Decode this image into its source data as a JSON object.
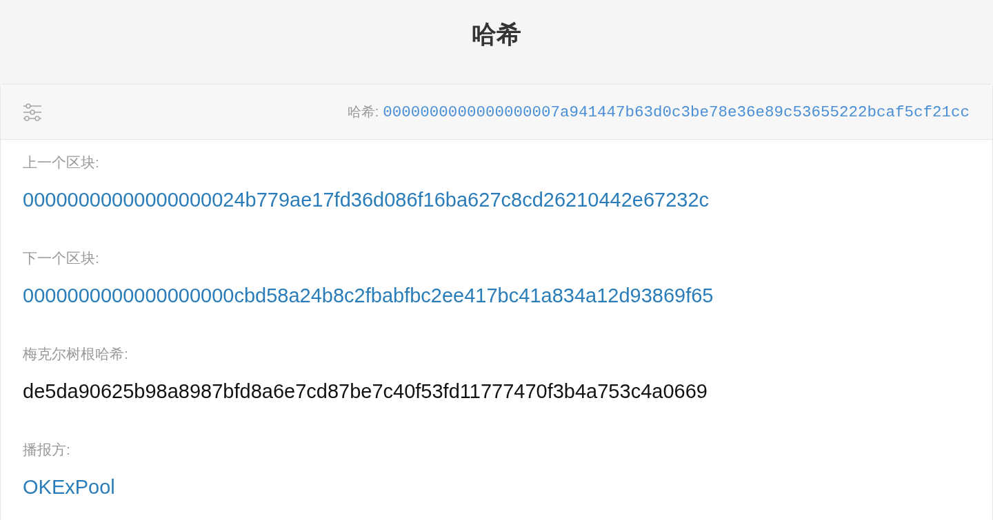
{
  "page_title": "哈希",
  "card": {
    "header": {
      "label": "哈希:",
      "value": "0000000000000000007a941447b63d0c3be78e36e89c53655222bcaf5cf21cc"
    },
    "fields": [
      {
        "label": "上一个区块:",
        "value": "00000000000000000024b779ae17fd36d086f16ba627c8cd26210442e67232c",
        "kind": "link"
      },
      {
        "label": "下一个区块:",
        "value": "0000000000000000000cbd58a24b8c2fbabfbc2ee417bc41a834a12d93869f65",
        "kind": "link"
      },
      {
        "label": "梅克尔树根哈希:",
        "value": "de5da90625b98a8987bfd8a6e7cd87be7c40f53fd11777470f3b4a753c4a0669",
        "kind": "text"
      },
      {
        "label": "播报方:",
        "value": "OKExPool",
        "kind": "link"
      }
    ]
  }
}
